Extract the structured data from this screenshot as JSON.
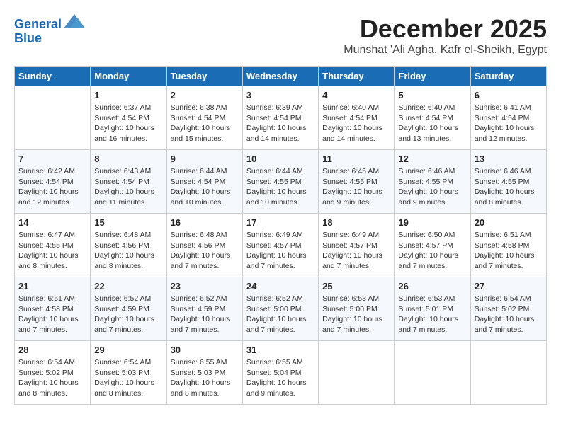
{
  "logo": {
    "line1": "General",
    "line2": "Blue"
  },
  "header": {
    "month": "December 2025",
    "location": "Munshat 'Ali Agha, Kafr el-Sheikh, Egypt"
  },
  "weekdays": [
    "Sunday",
    "Monday",
    "Tuesday",
    "Wednesday",
    "Thursday",
    "Friday",
    "Saturday"
  ],
  "weeks": [
    [
      {
        "day": "",
        "info": ""
      },
      {
        "day": "1",
        "info": "Sunrise: 6:37 AM\nSunset: 4:54 PM\nDaylight: 10 hours\nand 16 minutes."
      },
      {
        "day": "2",
        "info": "Sunrise: 6:38 AM\nSunset: 4:54 PM\nDaylight: 10 hours\nand 15 minutes."
      },
      {
        "day": "3",
        "info": "Sunrise: 6:39 AM\nSunset: 4:54 PM\nDaylight: 10 hours\nand 14 minutes."
      },
      {
        "day": "4",
        "info": "Sunrise: 6:40 AM\nSunset: 4:54 PM\nDaylight: 10 hours\nand 14 minutes."
      },
      {
        "day": "5",
        "info": "Sunrise: 6:40 AM\nSunset: 4:54 PM\nDaylight: 10 hours\nand 13 minutes."
      },
      {
        "day": "6",
        "info": "Sunrise: 6:41 AM\nSunset: 4:54 PM\nDaylight: 10 hours\nand 12 minutes."
      }
    ],
    [
      {
        "day": "7",
        "info": "Sunrise: 6:42 AM\nSunset: 4:54 PM\nDaylight: 10 hours\nand 12 minutes."
      },
      {
        "day": "8",
        "info": "Sunrise: 6:43 AM\nSunset: 4:54 PM\nDaylight: 10 hours\nand 11 minutes."
      },
      {
        "day": "9",
        "info": "Sunrise: 6:44 AM\nSunset: 4:54 PM\nDaylight: 10 hours\nand 10 minutes."
      },
      {
        "day": "10",
        "info": "Sunrise: 6:44 AM\nSunset: 4:55 PM\nDaylight: 10 hours\nand 10 minutes."
      },
      {
        "day": "11",
        "info": "Sunrise: 6:45 AM\nSunset: 4:55 PM\nDaylight: 10 hours\nand 9 minutes."
      },
      {
        "day": "12",
        "info": "Sunrise: 6:46 AM\nSunset: 4:55 PM\nDaylight: 10 hours\nand 9 minutes."
      },
      {
        "day": "13",
        "info": "Sunrise: 6:46 AM\nSunset: 4:55 PM\nDaylight: 10 hours\nand 8 minutes."
      }
    ],
    [
      {
        "day": "14",
        "info": "Sunrise: 6:47 AM\nSunset: 4:55 PM\nDaylight: 10 hours\nand 8 minutes."
      },
      {
        "day": "15",
        "info": "Sunrise: 6:48 AM\nSunset: 4:56 PM\nDaylight: 10 hours\nand 8 minutes."
      },
      {
        "day": "16",
        "info": "Sunrise: 6:48 AM\nSunset: 4:56 PM\nDaylight: 10 hours\nand 7 minutes."
      },
      {
        "day": "17",
        "info": "Sunrise: 6:49 AM\nSunset: 4:57 PM\nDaylight: 10 hours\nand 7 minutes."
      },
      {
        "day": "18",
        "info": "Sunrise: 6:49 AM\nSunset: 4:57 PM\nDaylight: 10 hours\nand 7 minutes."
      },
      {
        "day": "19",
        "info": "Sunrise: 6:50 AM\nSunset: 4:57 PM\nDaylight: 10 hours\nand 7 minutes."
      },
      {
        "day": "20",
        "info": "Sunrise: 6:51 AM\nSunset: 4:58 PM\nDaylight: 10 hours\nand 7 minutes."
      }
    ],
    [
      {
        "day": "21",
        "info": "Sunrise: 6:51 AM\nSunset: 4:58 PM\nDaylight: 10 hours\nand 7 minutes."
      },
      {
        "day": "22",
        "info": "Sunrise: 6:52 AM\nSunset: 4:59 PM\nDaylight: 10 hours\nand 7 minutes."
      },
      {
        "day": "23",
        "info": "Sunrise: 6:52 AM\nSunset: 4:59 PM\nDaylight: 10 hours\nand 7 minutes."
      },
      {
        "day": "24",
        "info": "Sunrise: 6:52 AM\nSunset: 5:00 PM\nDaylight: 10 hours\nand 7 minutes."
      },
      {
        "day": "25",
        "info": "Sunrise: 6:53 AM\nSunset: 5:00 PM\nDaylight: 10 hours\nand 7 minutes."
      },
      {
        "day": "26",
        "info": "Sunrise: 6:53 AM\nSunset: 5:01 PM\nDaylight: 10 hours\nand 7 minutes."
      },
      {
        "day": "27",
        "info": "Sunrise: 6:54 AM\nSunset: 5:02 PM\nDaylight: 10 hours\nand 7 minutes."
      }
    ],
    [
      {
        "day": "28",
        "info": "Sunrise: 6:54 AM\nSunset: 5:02 PM\nDaylight: 10 hours\nand 8 minutes."
      },
      {
        "day": "29",
        "info": "Sunrise: 6:54 AM\nSunset: 5:03 PM\nDaylight: 10 hours\nand 8 minutes."
      },
      {
        "day": "30",
        "info": "Sunrise: 6:55 AM\nSunset: 5:03 PM\nDaylight: 10 hours\nand 8 minutes."
      },
      {
        "day": "31",
        "info": "Sunrise: 6:55 AM\nSunset: 5:04 PM\nDaylight: 10 hours\nand 9 minutes."
      },
      {
        "day": "",
        "info": ""
      },
      {
        "day": "",
        "info": ""
      },
      {
        "day": "",
        "info": ""
      }
    ]
  ]
}
